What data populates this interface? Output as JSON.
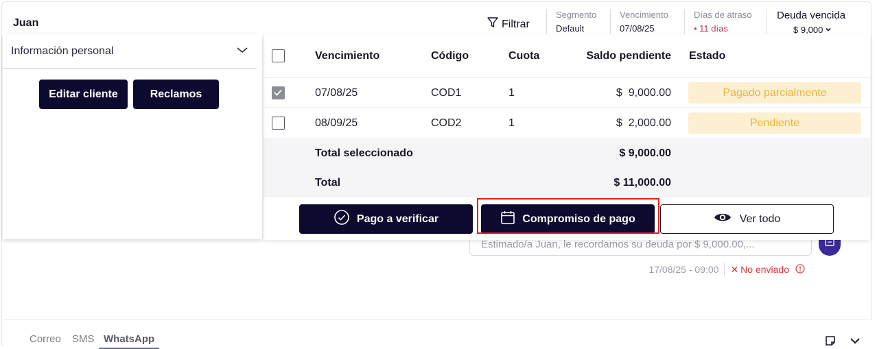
{
  "header": {
    "client_name": "Juan",
    "filter_label": "Filtrar",
    "segment": {
      "label": "Segmento",
      "value": "Default"
    },
    "due": {
      "label": "Vencimiento",
      "value": "07/08/25"
    },
    "days_late": {
      "label": "Días de atraso",
      "value": "11 días"
    },
    "overdue_debt": {
      "label": "Deuda vencida",
      "value": "$ 9,000"
    }
  },
  "left_panel": {
    "accordion_title": "Información personal",
    "edit_button": "Editar cliente",
    "claims_button": "Reclamos"
  },
  "table": {
    "columns": [
      "Vencimiento",
      "Código",
      "Cuota",
      "Saldo pendiente",
      "Estado"
    ],
    "rows": [
      {
        "checked": true,
        "due": "07/08/25",
        "code": "COD1",
        "installment": "1",
        "balance": "$  9,000.00",
        "status": "Pagado parcialmente"
      },
      {
        "checked": false,
        "due": "08/09/25",
        "code": "COD2",
        "installment": "1",
        "balance": "$  2,000.00",
        "status": "Pendiente"
      }
    ],
    "total_selected_label": "Total seleccionado",
    "total_selected_value": "$ 9,000.00",
    "total_label": "Total",
    "total_value": "$ 11,000.00"
  },
  "actions": {
    "verify_payment": "Pago a verificar",
    "payment_commitment": "Compromiso de pago",
    "view_all": "Ver todo"
  },
  "message": {
    "preview": "Estimado/a Juan, le recordamos su deuda por $ 9,000.00,...",
    "timestamp": "17/08/25 - 09:00",
    "status": "No enviado"
  },
  "channels": {
    "tabs": [
      "Correo",
      "SMS",
      "WhatsApp"
    ],
    "active": "WhatsApp"
  },
  "colors": {
    "primary_dark": "#0c0a2e",
    "badge_bg": "#fdf0d2",
    "badge_text": "#e9b33b",
    "error": "#d93a3a",
    "highlight": "#e0201d"
  }
}
